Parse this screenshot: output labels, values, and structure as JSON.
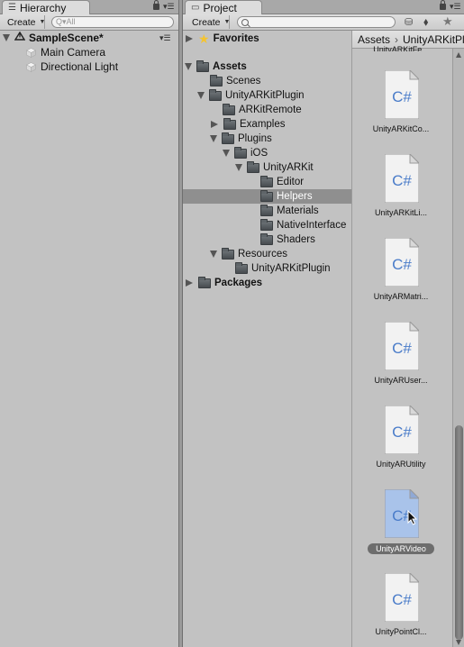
{
  "hierarchy": {
    "tab_label": "Hierarchy",
    "create_label": "Create",
    "search_placeholder": "Q▾All",
    "scene_name": "SampleScene*",
    "objects": [
      "Main Camera",
      "Directional Light"
    ]
  },
  "project": {
    "tab_label": "Project",
    "create_label": "Create",
    "favorites_label": "Favorites",
    "tree": [
      {
        "label": "Assets",
        "depth": 0,
        "arrow": "down",
        "bold": true
      },
      {
        "label": "Scenes",
        "depth": 1,
        "arrow": "none"
      },
      {
        "label": "UnityARKitPlugin",
        "depth": 1,
        "arrow": "down"
      },
      {
        "label": "ARKitRemote",
        "depth": 2,
        "arrow": "none"
      },
      {
        "label": "Examples",
        "depth": 2,
        "arrow": "right"
      },
      {
        "label": "Plugins",
        "depth": 2,
        "arrow": "down"
      },
      {
        "label": "iOS",
        "depth": 3,
        "arrow": "down"
      },
      {
        "label": "UnityARKit",
        "depth": 4,
        "arrow": "down"
      },
      {
        "label": "Editor",
        "depth": 5,
        "arrow": "none"
      },
      {
        "label": "Helpers",
        "depth": 5,
        "arrow": "none",
        "selected": true
      },
      {
        "label": "Materials",
        "depth": 5,
        "arrow": "none"
      },
      {
        "label": "NativeInterface",
        "depth": 5,
        "arrow": "none"
      },
      {
        "label": "Shaders",
        "depth": 5,
        "arrow": "none"
      },
      {
        "label": "Resources",
        "depth": 2,
        "arrow": "down"
      },
      {
        "label": "UnityARKitPlugin",
        "depth": 3,
        "arrow": "none"
      }
    ],
    "packages_label": "Packages",
    "breadcrumb": [
      "Assets",
      "UnityARKitPl"
    ],
    "top_partial_label": "UnityARKitFe...",
    "assets": [
      {
        "label": "UnityARKitCo...",
        "selected": false
      },
      {
        "label": "UnityARKitLi...",
        "selected": false
      },
      {
        "label": "UnityARMatri...",
        "selected": false
      },
      {
        "label": "UnityARUser...",
        "selected": false
      },
      {
        "label": "UnityARUtility",
        "selected": false
      },
      {
        "label": "UnityARVideo",
        "selected": true
      },
      {
        "label": "UnityPointCl...",
        "selected": false
      }
    ],
    "file_icon_text": "C#",
    "scroll_position": 0.64
  },
  "colors": {
    "panel_bg": "#c2c2c2",
    "selection_bg": "#8f8f8f",
    "csharp_blue": "#4a7cc9"
  }
}
